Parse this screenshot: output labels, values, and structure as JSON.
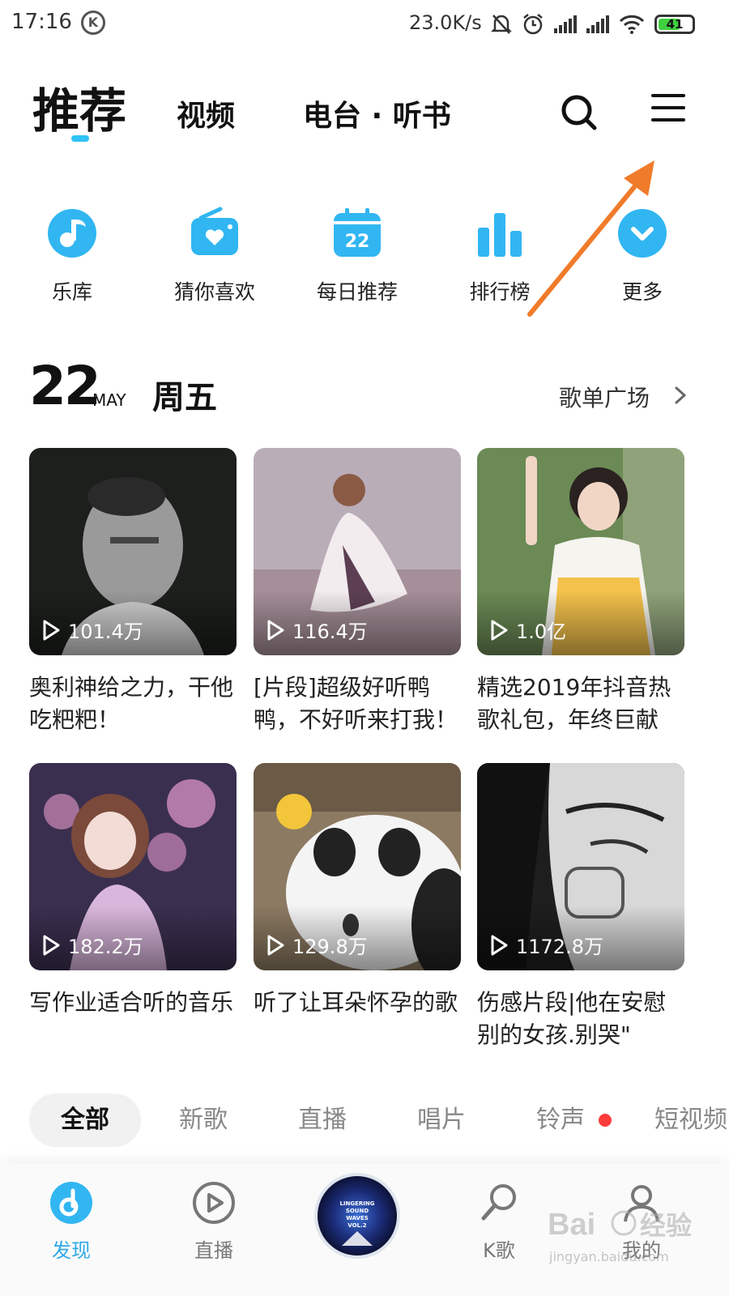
{
  "status_bar": {
    "time": "17:16",
    "k_badge": "K",
    "net_speed": "23.0K/s",
    "battery": "41",
    "icons": [
      "mute-bell-icon",
      "alarm-icon",
      "signal-icon",
      "signal-icon",
      "wifi-icon",
      "battery-icon"
    ]
  },
  "top_tabs": {
    "items": [
      "推荐",
      "视频",
      "电台 · 听书"
    ],
    "active_index": 0,
    "actions": [
      "search-icon",
      "menu-icon"
    ],
    "accent_color": "#31c2f5"
  },
  "quick_entries": [
    {
      "label": "乐库",
      "icon": "music-note-icon"
    },
    {
      "label": "猜你喜欢",
      "icon": "radio-heart-icon"
    },
    {
      "label": "每日推荐",
      "icon": "calendar-icon",
      "icon_text": "22"
    },
    {
      "label": "排行榜",
      "icon": "chart-bars-icon"
    },
    {
      "label": "更多",
      "icon": "chevron-down-icon"
    }
  ],
  "daily": {
    "day": "22",
    "month": "MAY",
    "weekday": "周五",
    "plaza_link": "歌单广场"
  },
  "playlists": [
    {
      "title": "奥利神给之力，干他吃粑粑！",
      "plays": "101.4万",
      "cover": "bw-portrait"
    },
    {
      "title": "[片段]超级好听鸭鸭，不好听来打我！",
      "plays": "116.4万",
      "cover": "anime-dancer"
    },
    {
      "title": "精选2019年抖音热歌礼包，年终巨献",
      "plays": "1.0亿",
      "cover": "girl-swing"
    },
    {
      "title": "写作业适合听的音乐",
      "plays": "182.2万",
      "cover": "anime-blossom"
    },
    {
      "title": "听了让耳朵怀孕的歌",
      "plays": "129.8万",
      "cover": "panda-cartoon"
    },
    {
      "title": "伤感片段|他在安慰别的女孩.别哭\"",
      "plays": "1172.8万",
      "cover": "manga-face"
    }
  ],
  "categories": {
    "items": [
      "全部",
      "新歌",
      "直播",
      "唱片",
      "铃声",
      "短视频"
    ],
    "active_index": 0,
    "dot_on": "铃声",
    "dot_color": "#ff3b3b"
  },
  "bottom_nav": {
    "items": [
      {
        "label": "发现",
        "icon": "discover-icon",
        "active": true
      },
      {
        "label": "直播",
        "icon": "live-play-icon",
        "active": false
      },
      {
        "label": "K歌",
        "icon": "microphone-icon",
        "active": false
      },
      {
        "label": "我的",
        "icon": "user-icon",
        "active": false
      }
    ],
    "now_playing_cover_text": [
      "LINGERING",
      "SOUND",
      "WAVES",
      "VOL.2"
    ],
    "active_color": "#31a8e8"
  },
  "watermark": {
    "brand": "Bai",
    "brand_cn": "经验",
    "url": "jingyan.baidu.com"
  },
  "annotation_color": "#f07b2a"
}
